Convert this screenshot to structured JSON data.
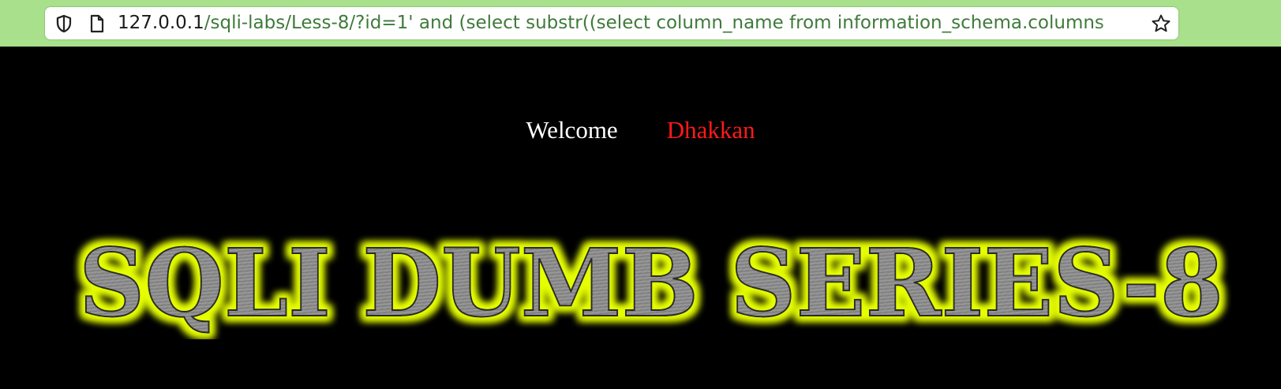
{
  "browser": {
    "url_host": "127.0.0.1",
    "url_rest": "/sqli-labs/Less-8/?id=1' and (select substr((select column_name from information_schema.columns",
    "icons": {
      "security": "shield-icon",
      "page": "page-icon",
      "bookmark": "star-icon"
    }
  },
  "page": {
    "welcome": "Welcome",
    "name": "Dhakkan",
    "banner": "SQLI DUMB SERIES-8"
  },
  "colors": {
    "toolbar_bg": "#a8e08c",
    "page_bg": "#000000",
    "welcome_text": "#ffffff",
    "name_text": "#ff1a1a",
    "banner_glow": "#e6ff00",
    "banner_fill": "#8a8a8a"
  }
}
